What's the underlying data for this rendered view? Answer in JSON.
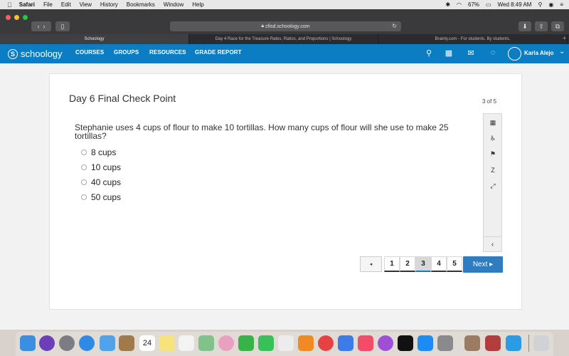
{
  "menubar": {
    "app": "Safari",
    "items": [
      "File",
      "Edit",
      "View",
      "History",
      "Bookmarks",
      "Window",
      "Help"
    ],
    "battery": "67%",
    "clock": "Wed 8:49 AM"
  },
  "browser": {
    "url": "cfisd.schoology.com",
    "tabs": [
      "Schoology",
      "Day 4 Race for the Treasure Rates, Ratios, and Proportions | Schoology",
      "Brainly.com - For students. By students."
    ]
  },
  "header": {
    "logo": "schoology",
    "nav": [
      "COURSES",
      "GROUPS",
      "RESOURCES",
      "GRADE REPORT"
    ],
    "user": "Karla Alejo",
    "brand_color": "#0b7ec3"
  },
  "quiz": {
    "title": "Day 6 Final Check Point",
    "counter": "3 of 5",
    "question": "Stephanie uses 4 cups of flour to make 10 tortillas. How many cups of flour will she use to make 25 tortillas?",
    "options": [
      "8 cups",
      "10 cups",
      "40 cups",
      "50 cups"
    ],
    "pages": [
      "1",
      "2",
      "3",
      "4",
      "5"
    ],
    "current_page": "3",
    "prev_label": "◂",
    "next_label": "Next ▸"
  },
  "tools": [
    "calendar-icon",
    "accessibility-icon",
    "flag-icon",
    "strike-icon",
    "expand-icon"
  ],
  "dock": {
    "calendar_day": "24"
  }
}
